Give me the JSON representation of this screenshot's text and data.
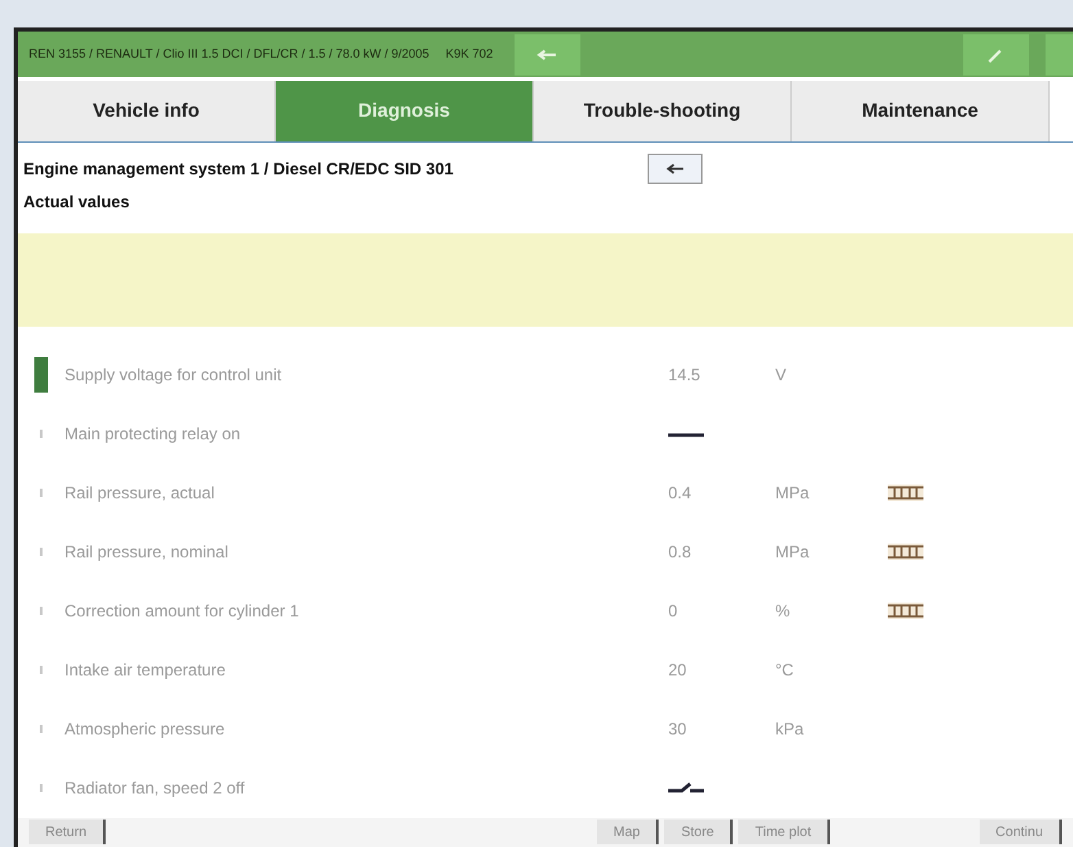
{
  "header": {
    "vehicle": "REN 3155 / RENAULT / Clio III 1.5 DCI / DFL/CR / 1.5 / 78.0 kW / 9/2005",
    "engine": "K9K 702"
  },
  "tabs": [
    {
      "label": "Vehicle info",
      "selected": false
    },
    {
      "label": "Diagnosis",
      "selected": true
    },
    {
      "label": "Trouble-shooting",
      "selected": false
    },
    {
      "label": "Maintenance",
      "selected": false
    }
  ],
  "breadcrumb": "Engine management system 1 / Diesel CR/EDC SID 301",
  "section_title": "Actual values",
  "rows": [
    {
      "kind": "numeric",
      "name": "Supply voltage for control unit",
      "value": "14.5",
      "unit": "V",
      "plot": false,
      "selected": true
    },
    {
      "kind": "switch",
      "name": "Main protecting relay on",
      "on": true,
      "selected": false
    },
    {
      "kind": "numeric",
      "name": "Rail pressure, actual",
      "value": "0.4",
      "unit": "MPa",
      "plot": true,
      "selected": false
    },
    {
      "kind": "numeric",
      "name": "Rail pressure, nominal",
      "value": "0.8",
      "unit": "MPa",
      "plot": true,
      "selected": false
    },
    {
      "kind": "numeric",
      "name": "Correction amount for cylinder 1",
      "value": "0",
      "unit": "%",
      "plot": true,
      "selected": false
    },
    {
      "kind": "numeric",
      "name": "Intake air temperature",
      "value": "20",
      "unit": "°C",
      "plot": false,
      "selected": false
    },
    {
      "kind": "numeric",
      "name": "Atmospheric pressure",
      "value": "30",
      "unit": "kPa",
      "plot": false,
      "selected": false
    },
    {
      "kind": "switch",
      "name": "Radiator fan, speed 2 off",
      "on": false,
      "selected": false
    }
  ],
  "buttons": [
    {
      "label": "Return"
    },
    {
      "label": "Map"
    },
    {
      "label": "Store"
    },
    {
      "label": "Time plot"
    },
    {
      "label": "Continu"
    }
  ]
}
